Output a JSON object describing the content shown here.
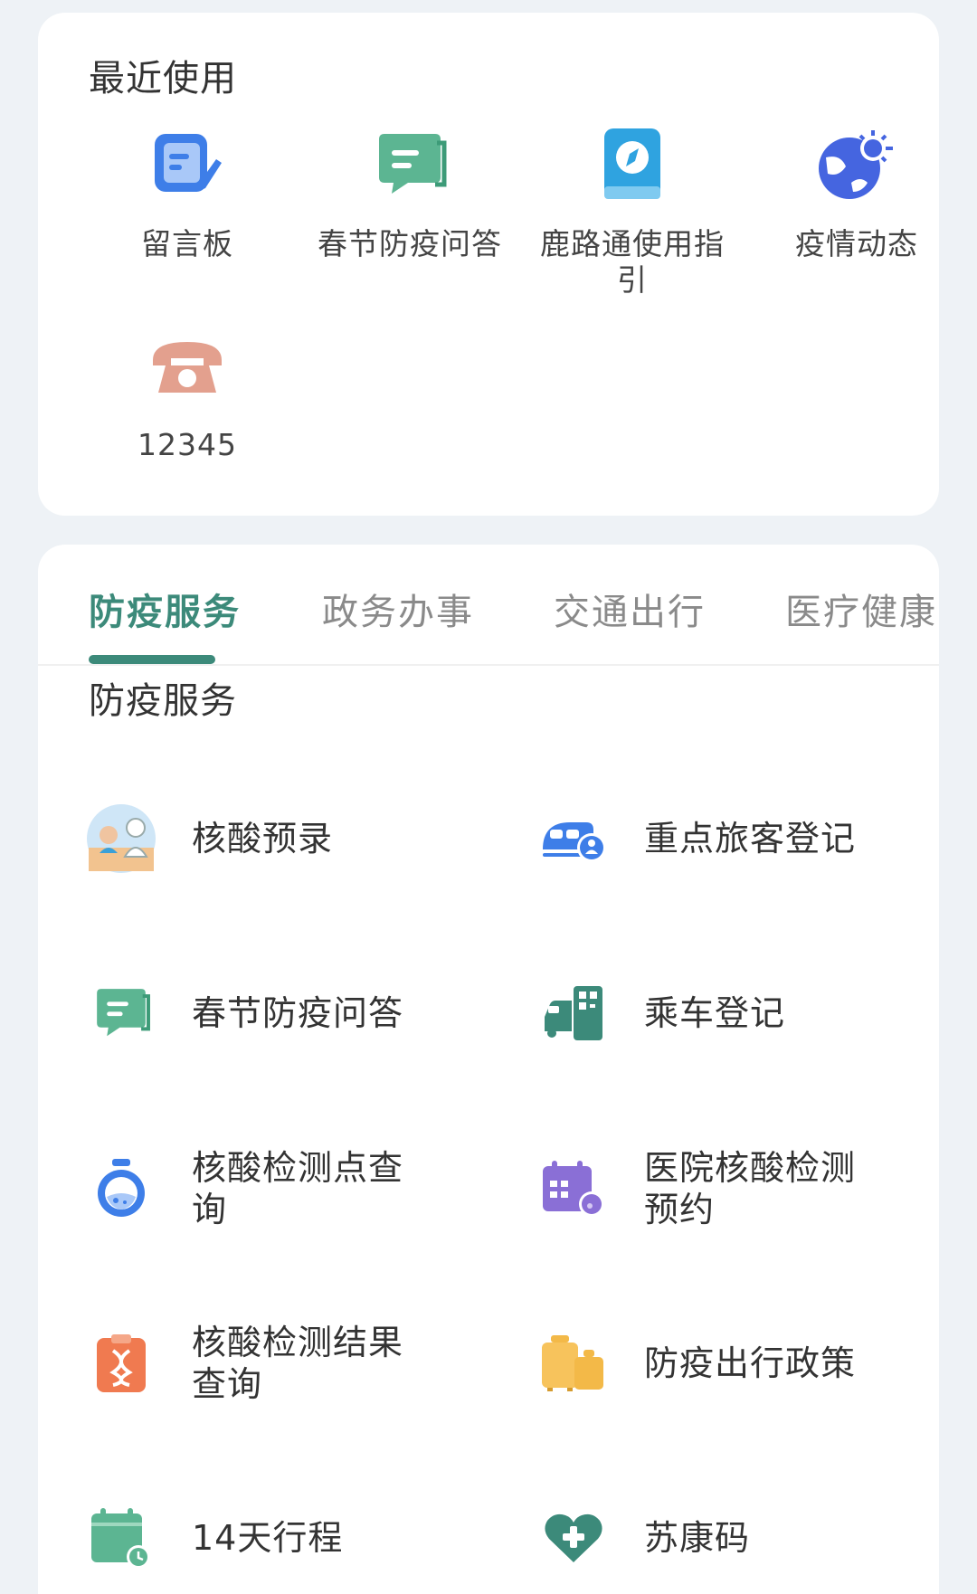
{
  "recent": {
    "title": "最近使用",
    "items": [
      {
        "label": "留言板",
        "icon": "note-board-icon"
      },
      {
        "label": "春节防疫问答",
        "icon": "chat-bubble-icon"
      },
      {
        "label": "鹿路通使用指引",
        "icon": "guide-book-icon"
      },
      {
        "label": "疫情动态",
        "icon": "globe-virus-icon"
      },
      {
        "label": "12345",
        "icon": "telephone-icon"
      }
    ]
  },
  "tabs": [
    {
      "label": "防疫服务",
      "active": true
    },
    {
      "label": "政务办事"
    },
    {
      "label": "交通出行"
    },
    {
      "label": "医疗健康"
    }
  ],
  "services": {
    "title": "防疫服务",
    "items": [
      {
        "label": "核酸预录",
        "icon": "nucleic-test-avatar-icon"
      },
      {
        "label": "重点旅客登记",
        "icon": "train-passenger-icon"
      },
      {
        "label": "春节防疫问答",
        "icon": "chat-bubble-icon"
      },
      {
        "label": "乘车登记",
        "icon": "car-qrcode-icon"
      },
      {
        "label": "核酸检测点查询",
        "icon": "flask-icon"
      },
      {
        "label": "医院核酸检测预约",
        "icon": "calendar-flask-icon"
      },
      {
        "label": "核酸检测结果查询",
        "icon": "dna-clipboard-icon"
      },
      {
        "label": "防疫出行政策",
        "icon": "luggage-icon"
      },
      {
        "label": "14天行程",
        "icon": "calendar-clock-icon"
      },
      {
        "label": "苏康码",
        "icon": "heart-plus-icon"
      }
    ]
  },
  "colors": {
    "accent": "#3c8a7a",
    "blue": "#3e7ee8",
    "green": "#5cb592",
    "tab_inactive": "#8a8a8a"
  }
}
